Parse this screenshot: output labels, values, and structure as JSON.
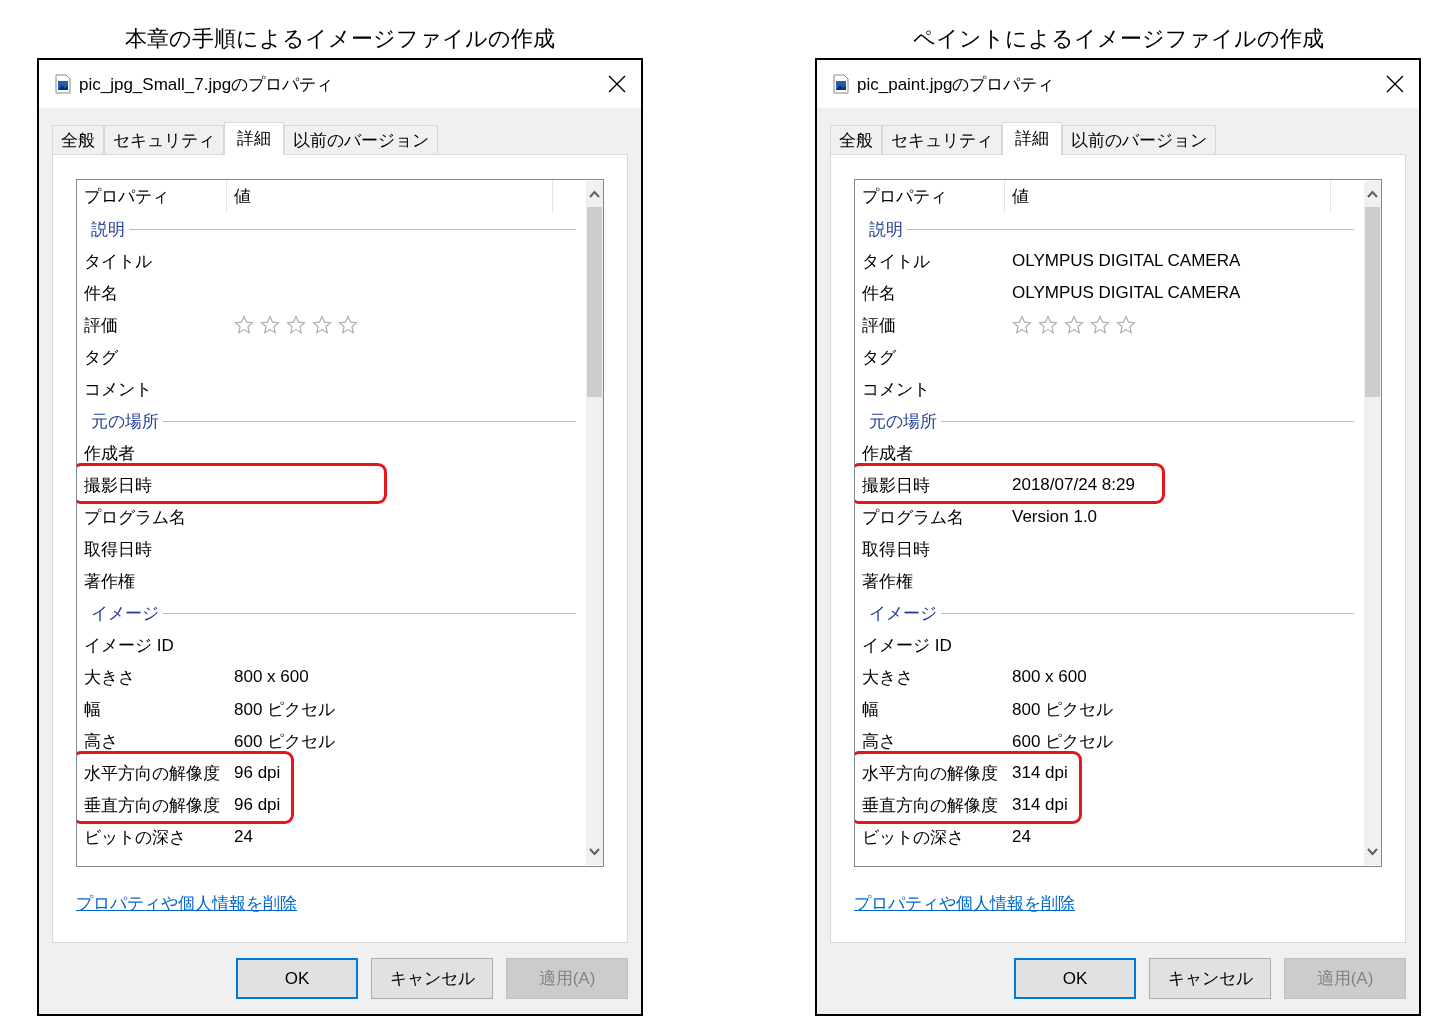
{
  "panels": [
    {
      "caption": "本章の手順によるイメージファイルの作成",
      "dialog": {
        "title": "pic_jpg_Small_7.jpgのプロパティ",
        "tabs": [
          {
            "label": "全般",
            "selected": false
          },
          {
            "label": "セキュリティ",
            "selected": false
          },
          {
            "label": "詳細",
            "selected": true
          },
          {
            "label": "以前のバージョン",
            "selected": false
          }
        ],
        "columns": [
          "プロパティ",
          "値"
        ],
        "rows": [
          {
            "kind": "group",
            "label": "説明"
          },
          {
            "kind": "prop",
            "name": "タイトル",
            "highlighted": false
          },
          {
            "kind": "prop",
            "name": "件名",
            "highlighted": false
          },
          {
            "kind": "rating",
            "name": "評価",
            "stars": 0
          },
          {
            "kind": "prop",
            "name": "タグ",
            "highlighted": false
          },
          {
            "kind": "prop",
            "name": "コメント",
            "highlighted": false
          },
          {
            "kind": "group",
            "label": "元の場所"
          },
          {
            "kind": "prop",
            "name": "作成者",
            "highlighted": false
          },
          {
            "kind": "prop",
            "name": "撮影日時",
            "highlighted": true
          },
          {
            "kind": "prop",
            "name": "プログラム名",
            "highlighted": false
          },
          {
            "kind": "prop",
            "name": "取得日時",
            "highlighted": false
          },
          {
            "kind": "prop",
            "name": "著作権",
            "highlighted": false
          },
          {
            "kind": "group",
            "label": "イメージ"
          },
          {
            "kind": "prop",
            "name": "イメージ ID",
            "highlighted": false
          },
          {
            "kind": "prop",
            "name": "大きさ",
            "value": "800 x 600",
            "highlighted": false
          },
          {
            "kind": "prop",
            "name": "幅",
            "value": "800 ピクセル",
            "highlighted": false
          },
          {
            "kind": "prop",
            "name": "高さ",
            "value": "600 ピクセル",
            "highlighted": false
          },
          {
            "kind": "prop",
            "name": "水平方向の解像度",
            "value": "96 dpi",
            "highlighted": true
          },
          {
            "kind": "prop",
            "name": "垂直方向の解像度",
            "value": "96 dpi",
            "highlighted": true
          },
          {
            "kind": "prop",
            "name": "ビットの深さ",
            "value": "24",
            "highlighted": false
          }
        ],
        "link": "プロパティや個人情報を削除",
        "buttons": [
          {
            "label": "OK",
            "kind": "default",
            "disabled": false
          },
          {
            "label": "キャンセル",
            "kind": "normal",
            "disabled": false
          },
          {
            "label": "適用(A)",
            "kind": "normal",
            "disabled": true
          }
        ]
      }
    },
    {
      "caption": "ペイントによるイメージファイルの作成",
      "dialog": {
        "title": "pic_paint.jpgのプロパティ",
        "tabs": [
          {
            "label": "全般",
            "selected": false
          },
          {
            "label": "セキュリティ",
            "selected": false
          },
          {
            "label": "詳細",
            "selected": true
          },
          {
            "label": "以前のバージョン",
            "selected": false
          }
        ],
        "columns": [
          "プロパティ",
          "値"
        ],
        "rows": [
          {
            "kind": "group",
            "label": "説明"
          },
          {
            "kind": "prop",
            "name": "タイトル",
            "value": "OLYMPUS DIGITAL CAMERA",
            "highlighted": false
          },
          {
            "kind": "prop",
            "name": "件名",
            "value": "OLYMPUS DIGITAL CAMERA",
            "highlighted": false
          },
          {
            "kind": "rating",
            "name": "評価",
            "stars": 0
          },
          {
            "kind": "prop",
            "name": "タグ",
            "highlighted": false
          },
          {
            "kind": "prop",
            "name": "コメント",
            "highlighted": false
          },
          {
            "kind": "group",
            "label": "元の場所"
          },
          {
            "kind": "prop",
            "name": "作成者",
            "highlighted": false
          },
          {
            "kind": "prop",
            "name": "撮影日時",
            "value": "2018/07/24 8:29",
            "highlighted": true
          },
          {
            "kind": "prop",
            "name": "プログラム名",
            "value": "Version 1.0",
            "highlighted": false
          },
          {
            "kind": "prop",
            "name": "取得日時",
            "highlighted": false
          },
          {
            "kind": "prop",
            "name": "著作権",
            "highlighted": false
          },
          {
            "kind": "group",
            "label": "イメージ"
          },
          {
            "kind": "prop",
            "name": "イメージ ID",
            "highlighted": false
          },
          {
            "kind": "prop",
            "name": "大きさ",
            "value": "800 x 600",
            "highlighted": false
          },
          {
            "kind": "prop",
            "name": "幅",
            "value": "800 ピクセル",
            "highlighted": false
          },
          {
            "kind": "prop",
            "name": "高さ",
            "value": "600 ピクセル",
            "highlighted": false
          },
          {
            "kind": "prop",
            "name": "水平方向の解像度",
            "value": "314 dpi",
            "highlighted": true
          },
          {
            "kind": "prop",
            "name": "垂直方向の解像度",
            "value": "314 dpi",
            "highlighted": true
          },
          {
            "kind": "prop",
            "name": "ビットの深さ",
            "value": "24",
            "highlighted": false
          }
        ],
        "link": "プロパティや個人情報を削除",
        "buttons": [
          {
            "label": "OK",
            "kind": "default",
            "disabled": false
          },
          {
            "label": "キャンセル",
            "kind": "normal",
            "disabled": false
          },
          {
            "label": "適用(A)",
            "kind": "normal",
            "disabled": true
          }
        ]
      }
    }
  ]
}
